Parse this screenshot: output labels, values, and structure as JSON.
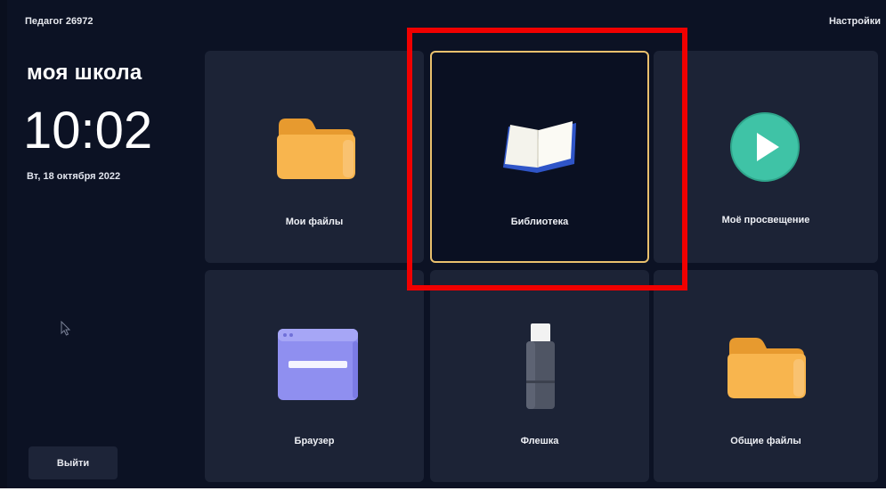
{
  "header": {
    "user_label": "Педагог 26972",
    "settings_label": "Настройки"
  },
  "sidebar": {
    "school_name": "моя школа",
    "time": "10:02",
    "date": "Вт, 18 октября 2022",
    "logout_label": "Выйти"
  },
  "tiles": [
    {
      "label": "Мои файлы",
      "icon": "folder-icon"
    },
    {
      "label": "Библиотека",
      "icon": "book-icon",
      "selected": true
    },
    {
      "label": "Моё просвещение",
      "icon": "play-icon"
    },
    {
      "label": "Браузер",
      "icon": "browser-window-icon"
    },
    {
      "label": "Флешка",
      "icon": "usb-drive-icon"
    },
    {
      "label": "Общие файлы",
      "icon": "folder-icon"
    }
  ],
  "colors": {
    "background": "#0c1224",
    "tile": "#1c2336",
    "selected_border": "#e9c06d",
    "highlight_frame": "#f00000",
    "folder": "#f6b04a",
    "play": "#3fc3a6",
    "browser": "#8f8ff0"
  }
}
